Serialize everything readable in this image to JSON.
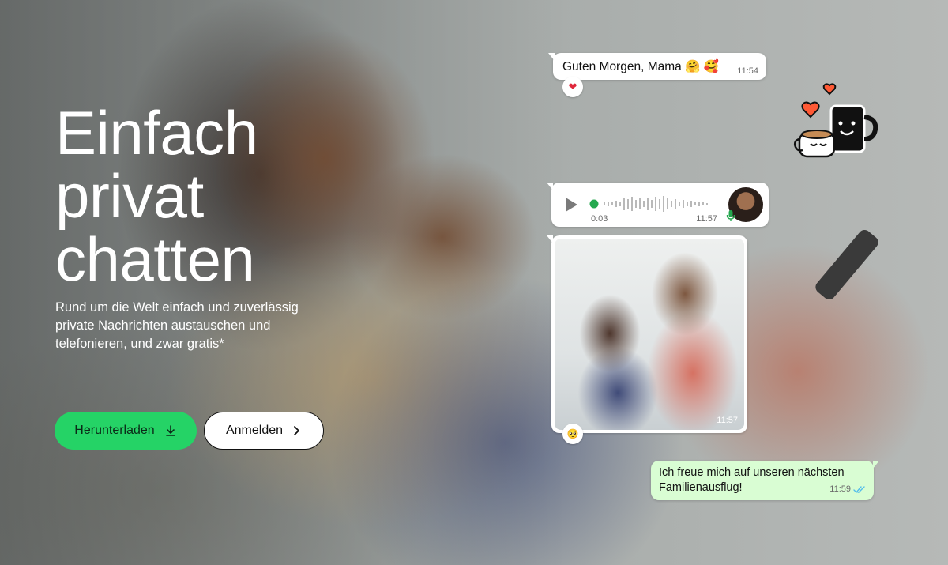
{
  "hero": {
    "headline": "Einfach privat chatten",
    "subline": "Rund um die Welt einfach und zuverlässig private Nachrichten austauschen und telefonieren, und zwar gratis*"
  },
  "buttons": {
    "download_label": "Herunterladen",
    "login_label": "Anmelden"
  },
  "chat": {
    "message_1": {
      "text": "Guten Morgen, Mama 🤗 🥰",
      "time": "11:54",
      "reaction": "❤"
    },
    "voice_note": {
      "duration": "0:03",
      "time": "11:57",
      "progress": 0.0
    },
    "photo_message": {
      "time": "11:57",
      "reaction": "🥺"
    },
    "message_2": {
      "text": "Ich freue mich auf unseren nächsten Familienausflug!",
      "time": "11:59"
    }
  },
  "icons": {
    "download": "download-icon",
    "chevron": "chevron-right-icon",
    "play": "play-icon",
    "mic": "mic-icon",
    "read": "double-check-icon",
    "sticker": "coffee-hearts-sticker"
  },
  "colors": {
    "accent": "#25d366",
    "outgoing_bubble": "#d9fdd3",
    "read_ticks": "#53bdeb"
  }
}
